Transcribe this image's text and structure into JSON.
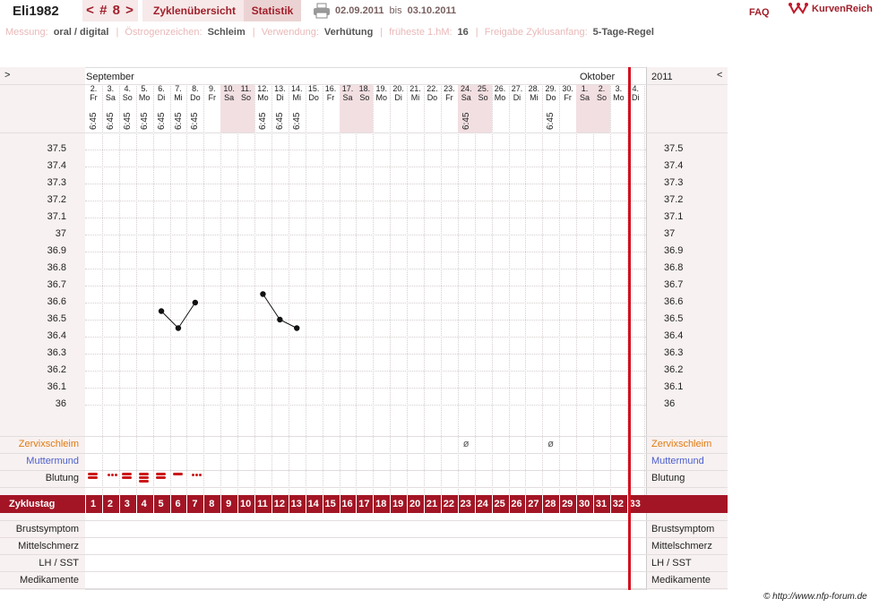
{
  "header": {
    "user": "Eli1982",
    "cycle_nav": "< # 8 >",
    "overview_tab": "Zyklenübersicht",
    "stats_tab": "Statistik",
    "date_from": "02.09.2011",
    "date_bis": "bis",
    "date_to": "03.10.2011",
    "faq": "FAQ",
    "logo_text": "KurvenReich"
  },
  "infobar": {
    "messung_label": "Messung:",
    "messung_value": "oral / digital",
    "oestrogen_label": "Östrogenzeichen:",
    "oestrogen_value": "Schleim",
    "verwendung_label": "Verwendung:",
    "verwendung_value": "Verhütung",
    "hm_label": "früheste 1.hM:",
    "hm_value": "16",
    "freigabe_label": "Freigabe Zyklusanfang:",
    "freigabe_value": "5-Tage-Regel"
  },
  "grid": {
    "toggle_left": ">",
    "toggle_right": "<",
    "month_1": "September",
    "month_2": "Oktober",
    "year": "2011",
    "days": [
      {
        "d": "2.",
        "w": "Fr",
        "t": "6:45",
        "we": false
      },
      {
        "d": "3.",
        "w": "Sa",
        "t": "6:45",
        "we": false
      },
      {
        "d": "4.",
        "w": "So",
        "t": "6:45",
        "we": false
      },
      {
        "d": "5.",
        "w": "Mo",
        "t": "6:45",
        "we": false
      },
      {
        "d": "6.",
        "w": "Di",
        "t": "6:45",
        "we": false
      },
      {
        "d": "7.",
        "w": "Mi",
        "t": "6:45",
        "we": false
      },
      {
        "d": "8.",
        "w": "Do",
        "t": "6:45",
        "we": false
      },
      {
        "d": "9.",
        "w": "Fr",
        "t": "",
        "we": false
      },
      {
        "d": "10.",
        "w": "Sa",
        "t": "",
        "we": true
      },
      {
        "d": "11.",
        "w": "So",
        "t": "",
        "we": true
      },
      {
        "d": "12.",
        "w": "Mo",
        "t": "6:45",
        "we": false
      },
      {
        "d": "13.",
        "w": "Di",
        "t": "6:45",
        "we": false
      },
      {
        "d": "14.",
        "w": "Mi",
        "t": "6:45",
        "we": false
      },
      {
        "d": "15.",
        "w": "Do",
        "t": "",
        "we": false
      },
      {
        "d": "16.",
        "w": "Fr",
        "t": "",
        "we": false
      },
      {
        "d": "17.",
        "w": "Sa",
        "t": "",
        "we": true
      },
      {
        "d": "18.",
        "w": "So",
        "t": "",
        "we": true
      },
      {
        "d": "19.",
        "w": "Mo",
        "t": "",
        "we": false
      },
      {
        "d": "20.",
        "w": "Di",
        "t": "",
        "we": false
      },
      {
        "d": "21.",
        "w": "Mi",
        "t": "",
        "we": false
      },
      {
        "d": "22.",
        "w": "Do",
        "t": "",
        "we": false
      },
      {
        "d": "23.",
        "w": "Fr",
        "t": "",
        "we": false
      },
      {
        "d": "24.",
        "w": "Sa",
        "t": "6:45",
        "we": true
      },
      {
        "d": "25.",
        "w": "So",
        "t": "",
        "we": true
      },
      {
        "d": "26.",
        "w": "Mo",
        "t": "",
        "we": false
      },
      {
        "d": "27.",
        "w": "Di",
        "t": "",
        "we": false
      },
      {
        "d": "28.",
        "w": "Mi",
        "t": "",
        "we": false
      },
      {
        "d": "29.",
        "w": "Do",
        "t": "6:45",
        "we": false
      },
      {
        "d": "30.",
        "w": "Fr",
        "t": "",
        "we": false
      },
      {
        "d": "1.",
        "w": "Sa",
        "t": "",
        "we": true
      },
      {
        "d": "2.",
        "w": "So",
        "t": "",
        "we": true
      },
      {
        "d": "3.",
        "w": "Mo",
        "t": "",
        "we": false
      },
      {
        "d": "4.",
        "w": "Di",
        "t": "",
        "we": false
      }
    ],
    "temp_ticks": [
      "37.5",
      "37.4",
      "37.3",
      "37.2",
      "37.1",
      "37",
      "36.9",
      "36.8",
      "36.7",
      "36.6",
      "36.5",
      "36.4",
      "36.3",
      "36.2",
      "36.1",
      "36"
    ],
    "row_labels": {
      "zervix": "Zervixschleim",
      "muttermund": "Muttermund",
      "blutung": "Blutung",
      "zyklustag": "Zyklustag",
      "brust": "Brustsymptom",
      "mittel": "Mittelschmerz",
      "lh": "LH / SST",
      "medikamente": "Medikamente"
    },
    "zervix_marks": [
      {
        "day": 23,
        "symbol": "ø"
      },
      {
        "day": 28,
        "symbol": "ø"
      }
    ],
    "blutung": [
      {
        "day": 1,
        "type": "double"
      },
      {
        "day": 2,
        "type": "dots"
      },
      {
        "day": 3,
        "type": "double"
      },
      {
        "day": 4,
        "type": "triple"
      },
      {
        "day": 5,
        "type": "double"
      },
      {
        "day": 6,
        "type": "single"
      },
      {
        "day": 7,
        "type": "dots"
      }
    ],
    "cycle_days": [
      "1",
      "2",
      "3",
      "4",
      "5",
      "6",
      "7",
      "8",
      "9",
      "10",
      "11",
      "12",
      "13",
      "14",
      "15",
      "16",
      "17",
      "18",
      "19",
      "20",
      "21",
      "22",
      "23",
      "24",
      "25",
      "26",
      "27",
      "28",
      "29",
      "30",
      "31",
      "32",
      "33"
    ]
  },
  "colors": {
    "accent": "#a31525",
    "redline": "#d41020",
    "zervix": "#e07a10",
    "muttermund": "#4a5fcc"
  },
  "copyright": "© http://www.nfp-forum.de",
  "chart_data": {
    "type": "line",
    "ylabel": "",
    "ylim": [
      36.0,
      37.5
    ],
    "series": [
      {
        "x": [
          5,
          6,
          7
        ],
        "values": [
          36.55,
          36.45,
          36.6
        ]
      },
      {
        "x": [
          11,
          12,
          13
        ],
        "values": [
          36.65,
          36.5,
          36.45
        ]
      }
    ]
  }
}
